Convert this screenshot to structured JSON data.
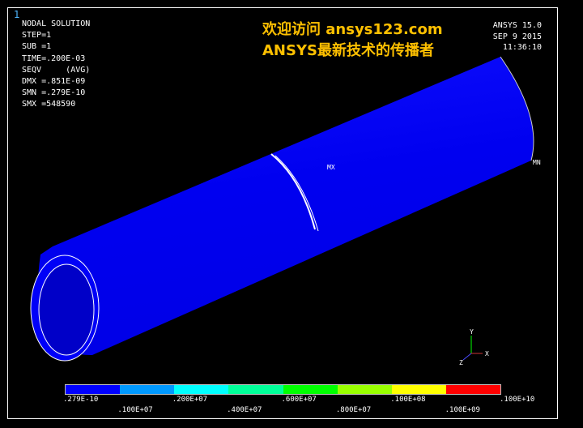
{
  "window_number": "1",
  "solution": {
    "title": "NODAL SOLUTION",
    "lines": [
      "STEP=1",
      "SUB =1",
      "TIME=.200E-03",
      "SEQV     (AVG)",
      "DMX =.851E-09",
      "SMN =.279E-10",
      "SMX =548590"
    ]
  },
  "brand": {
    "line1": "欢迎访问 ansys123.com",
    "line2": "ANSYS最新技术的传播者"
  },
  "version": {
    "product": "ANSYS 15.0",
    "date": "SEP  9 2015",
    "time": "11:36:10"
  },
  "markers": {
    "max": "MX",
    "min": "MN"
  },
  "triad": {
    "y": "Y",
    "z": "Z",
    "x": "X"
  },
  "legend": {
    "colors": [
      "#0000ff",
      "#0099ff",
      "#00ffff",
      "#00ff99",
      "#00ff00",
      "#99ff00",
      "#ffff00",
      "#ff0000"
    ],
    "top_labels": [
      ".279E-10",
      ".200E+07",
      ".600E+07",
      ".100E+08",
      ".100E+10"
    ],
    "bottom_labels": [
      ".100E+07",
      ".400E+07",
      ".800E+07",
      ".100E+09"
    ]
  },
  "colors": {
    "background": "#000000",
    "tube": "#0000ff",
    "brand": "#ffc000"
  }
}
